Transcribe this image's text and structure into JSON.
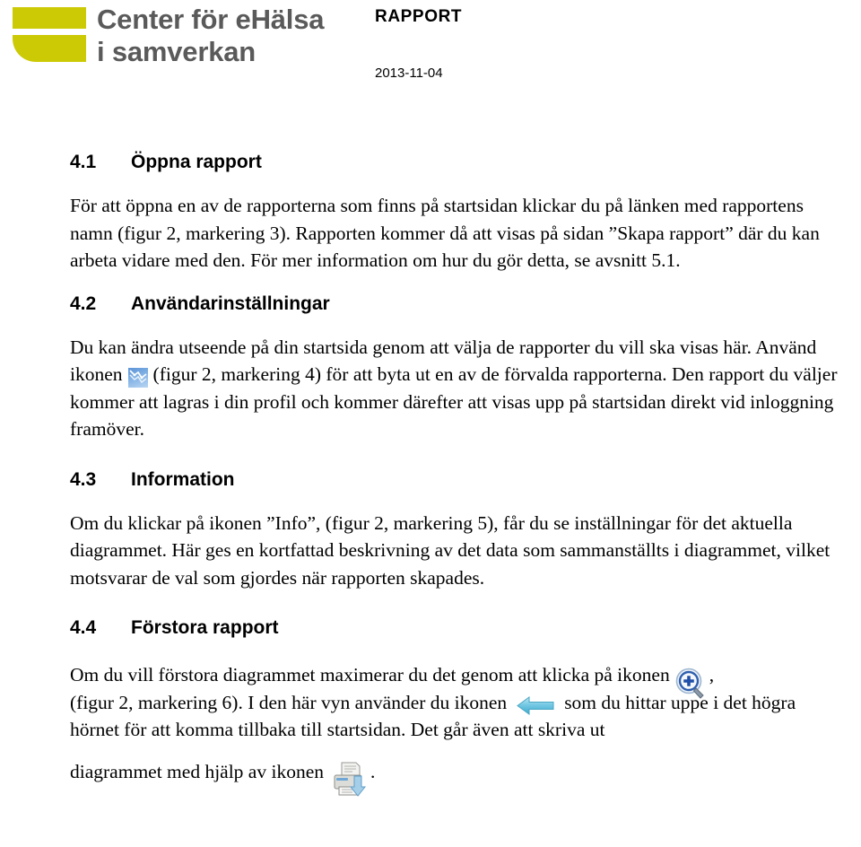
{
  "header": {
    "logo": {
      "line1": "Center för eHälsa",
      "line2": "i samverkan",
      "mark_color": "#ccc905",
      "text_color": "#5a5a5a",
      "icon_name": "cehis-logo"
    },
    "document_type": "RAPPORT",
    "date": "2013-11-04"
  },
  "sections": [
    {
      "number": "4.1",
      "title": "Öppna rapport",
      "paragraphs": [
        "För att öppna en av de rapporterna som finns på startsidan klickar du på länken med rapportens namn (figur 2, markering 3). Rapporten kommer då att visas på sidan ”Skapa rapport” där du kan arbeta vidare med den. För mer information om hur du gör detta, se avsnitt 5.1."
      ]
    },
    {
      "number": "4.2",
      "title": "Användarinställningar",
      "paragraph_before_icon": "Du kan ändra utseende på din startsida genom att välja de rapporter du vill ska visas här. Använd ikonen",
      "paragraph_after_icon": "(figur 2, markering 4) för att byta ut en av de förvalda rapporterna. Den rapport du väljer kommer att lagras i din profil och kommer därefter att visas upp på startsidan direkt vid inloggning framöver.",
      "icon_name": "chart-report-icon",
      "icon_color": "#6aa3dd"
    },
    {
      "number": "4.3",
      "title": "Information",
      "paragraphs": [
        "Om du klickar på ikonen ”Info”, (figur 2, markering 5), får du se inställningar för det aktuella diagrammet. Här ges en kortfattad beskrivning av det data som sammanställts i diagrammet, vilket motsvarar de val som gjordes när rapporten skapades."
      ]
    },
    {
      "number": "4.4",
      "title": "Förstora rapport",
      "text_a": "Om du vill förstora diagrammet maximerar du det genom att klicka på ikonen",
      "text_b": ",",
      "text_c": "(figur 2, markering 6). I den här vyn använder du ikonen",
      "text_d": "som du hittar uppe i det högra hörnet för att komma tillbaka till startsidan. Det går även att skriva ut",
      "text_e": "diagrammet med hjälp av ikonen",
      "text_f": ".",
      "icons": {
        "zoom_in": "zoom-in-magnifier-icon",
        "back_arrow": "back-arrow-icon",
        "print": "print-icon"
      },
      "icon_colors": {
        "zoom_in": "#1f4fa8",
        "back_arrow": "#6ec6e0",
        "print": "#8fb8d8"
      }
    }
  ]
}
